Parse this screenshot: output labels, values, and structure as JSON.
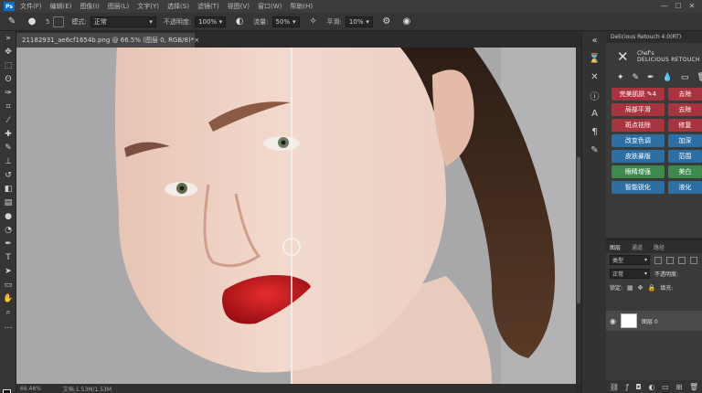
{
  "menubar": {
    "logo": "Ps",
    "items": [
      "文件(F)",
      "编辑(E)",
      "图像(I)",
      "图层(L)",
      "文字(Y)",
      "选择(S)",
      "滤镜(T)",
      "视图(V)",
      "窗口(W)",
      "帮助(H)"
    ],
    "window_buttons": [
      "—",
      "☐",
      "✕"
    ]
  },
  "options": {
    "mode_label": "模式:",
    "mode_value": "正常",
    "opacity_label": "不透明度:",
    "opacity_value": "100%",
    "flow_label": "流量:",
    "flow_value": "50%",
    "smooth_label": "平滑:",
    "smooth_value": "10%",
    "brush_size": "5"
  },
  "document": {
    "tab_title": "21182931_ae6cf1654b.png @ 66.5% (图层 0, RGB/8)",
    "tab_modified": "*",
    "tab_close": "×"
  },
  "status": {
    "zoom": "66.46%",
    "doc_info": "文档:1.53M/1.53M"
  },
  "plugin": {
    "tab_title": "Delicious Retouch 4.0(RT)",
    "brand_line1": "Chef's",
    "brand_line2": "DELICIOUS RETOUCH",
    "buttons": [
      {
        "label": "完美肌肤 ✎4",
        "color": "#a8343f"
      },
      {
        "label": "局部平滑",
        "color": "#a8343f"
      },
      {
        "label": "斑点祛除",
        "color": "#a8343f"
      },
      {
        "label": "改变色调",
        "color": "#2e6fa3"
      },
      {
        "label": "皮肤暴版",
        "color": "#2e6fa3"
      },
      {
        "label": "眼睛增强",
        "color": "#3e8a4e"
      },
      {
        "label": "智能锐化",
        "color": "#2e6fa3"
      }
    ],
    "buttons_right": [
      {
        "label": "去除",
        "color": "#a8343f"
      },
      {
        "label": "去除",
        "color": "#a8343f"
      },
      {
        "label": "修复",
        "color": "#a8343f"
      },
      {
        "label": "加深",
        "color": "#2e6fa3"
      },
      {
        "label": "范围",
        "color": "#2e6fa3"
      },
      {
        "label": "美白",
        "color": "#3e8a4e"
      },
      {
        "label": "液化",
        "color": "#2e6fa3"
      }
    ]
  },
  "layers": {
    "tabs": [
      "图层",
      "通道",
      "路径"
    ],
    "kind_label": "类型",
    "blend": "正常",
    "opacity": "不透明度:",
    "lock": "锁定:",
    "fill": "填充:",
    "layer_name": "图层 0"
  },
  "colors": {
    "accent": "#0d6ec7",
    "canvas_bg": "#a9a9a9"
  }
}
